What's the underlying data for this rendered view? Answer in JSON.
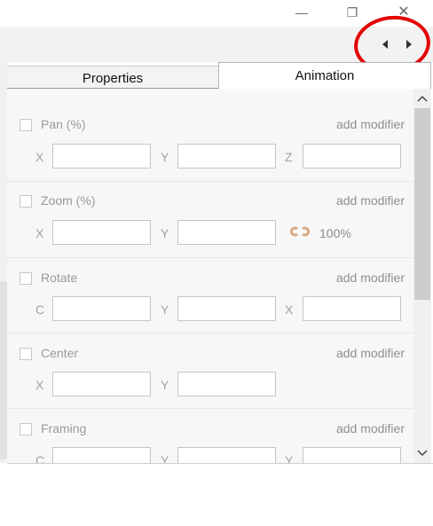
{
  "window": {
    "minimize": "—",
    "maximize": "❐",
    "close": "✕"
  },
  "nav": {
    "prev_icon": "caret-left-icon",
    "next_icon": "caret-right-icon"
  },
  "annotation": {
    "color": "#e30000"
  },
  "tabs": {
    "properties": "Properties",
    "animation": "Animation"
  },
  "rows": [
    {
      "title": "Pan  (%)",
      "modifier": "add modifier",
      "labels": [
        "X",
        "Y",
        "Z"
      ]
    },
    {
      "title": "Zoom  (%)",
      "modifier": "add modifier",
      "labels": [
        "X",
        "Y"
      ],
      "link_icon": "link-icon",
      "percent": "100%"
    },
    {
      "title": "Rotate",
      "modifier": "add modifier",
      "labels": [
        "C",
        "Y",
        "X"
      ]
    },
    {
      "title": "Center",
      "modifier": "add modifier",
      "labels": [
        "X",
        "Y"
      ]
    },
    {
      "title": "Framing",
      "modifier": "add modifier",
      "labels": [
        "C",
        "Y",
        "Y"
      ]
    }
  ]
}
